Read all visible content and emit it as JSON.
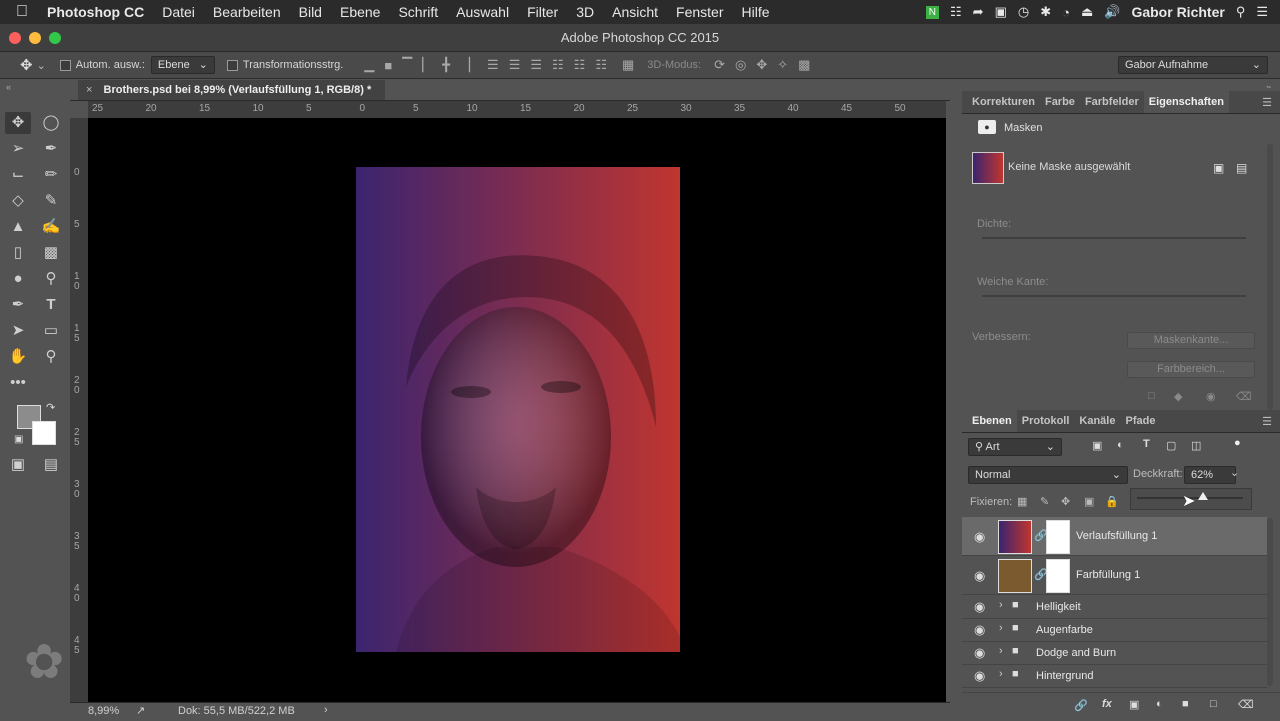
{
  "menubar": {
    "app": "Photoshop CC",
    "items": [
      "Datei",
      "Bearbeiten",
      "Bild",
      "Ebene",
      "Schrift",
      "Auswahl",
      "Filter",
      "3D",
      "Ansicht",
      "Fenster",
      "Hilfe"
    ],
    "user": "Gabor Richter"
  },
  "window": {
    "title": "Adobe Photoshop CC 2015"
  },
  "options": {
    "auto_select_label": "Autom. ausw.:",
    "auto_select_value": "Ebene",
    "transform_label": "Transformationsstrg.",
    "mode_3d_label": "3D-Modus:",
    "workspace": "Gabor Aufnahme"
  },
  "document": {
    "tab_title": "Brothers.psd bei 8,99% (Verlaufsfüllung 1, RGB/8) *",
    "zoom": "8,99%",
    "doc_info": "Dok: 55,5 MB/522,2 MB",
    "gradient_left": "#3b2470",
    "gradient_right": "#c0352f"
  },
  "rulers": {
    "h": [
      "25",
      "20",
      "15",
      "10",
      "5",
      "0",
      "5",
      "10",
      "15",
      "20",
      "25",
      "30",
      "35",
      "40",
      "45",
      "50"
    ],
    "v": [
      "0",
      "5",
      "1\n0",
      "1\n5",
      "2\n0",
      "2\n5",
      "3\n0",
      "3\n5",
      "4\n0",
      "4\n5"
    ]
  },
  "props_panel": {
    "tabs": [
      "Korrekturen",
      "Farbe",
      "Farbfelder",
      "Eigenschaften"
    ],
    "masks_title": "Masken",
    "no_mask": "Keine Maske ausgewählt",
    "density": "Dichte:",
    "feather": "Weiche Kante:",
    "refine": "Verbessern:",
    "mask_edge_btn": "Maskenkante...",
    "color_range_btn": "Farbbereich..."
  },
  "layers_panel": {
    "tabs": [
      "Ebenen",
      "Protokoll",
      "Kanäle",
      "Pfade"
    ],
    "filter_kind": "Art",
    "blend_mode": "Normal",
    "opacity_label": "Deckkraft:",
    "opacity_value": "62%",
    "opacity_fraction": 0.62,
    "lock_label": "Fixieren:",
    "layers": [
      {
        "name": "Verlaufsfüllung 1",
        "type": "gradient",
        "selected": true
      },
      {
        "name": "Farbfüllung 1",
        "type": "color",
        "color": "#7a5a2e"
      },
      {
        "name": "Helligkeit",
        "type": "group"
      },
      {
        "name": "Augenfarbe",
        "type": "group"
      },
      {
        "name": "Dodge and Burn",
        "type": "group"
      },
      {
        "name": "Hintergrund",
        "type": "group"
      }
    ]
  }
}
